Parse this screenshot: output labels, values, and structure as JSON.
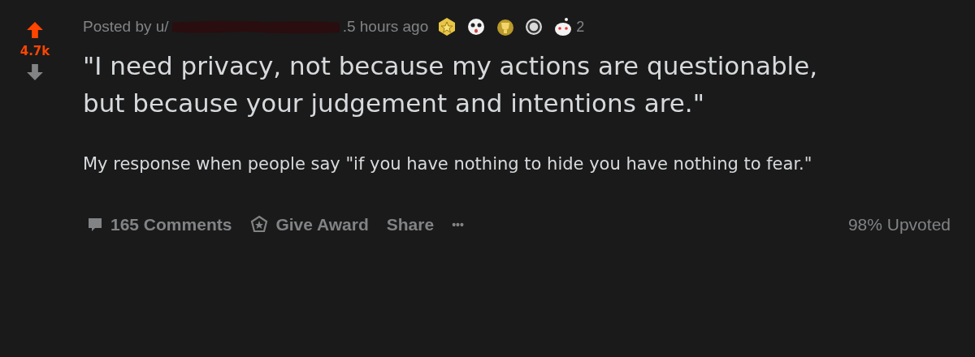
{
  "vote": {
    "upvoted": true,
    "score": "4.7k"
  },
  "header": {
    "posted_by": "Posted by u/",
    "time": ".5 hours ago",
    "award_count": "2"
  },
  "title": "\"I need privacy, not because my actions are questionable, but because your judgement and intentions are.\"",
  "body": "My response when people say \"if you have nothing to hide you have nothing to fear.\"",
  "footer": {
    "comments": "165 Comments",
    "award": "Give Award",
    "share": "Share",
    "more": "•••",
    "upvoted": "98% Upvoted"
  }
}
